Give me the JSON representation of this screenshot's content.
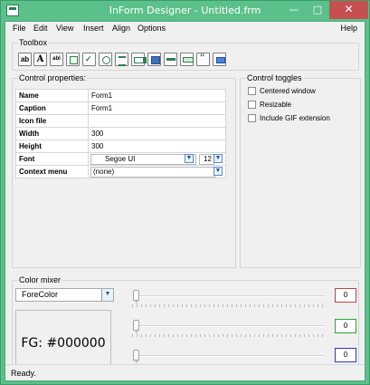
{
  "window": {
    "title": "InForm Designer - Untitled.frm",
    "controls": {
      "minimize": "—",
      "maximize": "□",
      "close": "✕"
    }
  },
  "menu": [
    "File",
    "Edit",
    "View",
    "Insert",
    "Align",
    "Options"
  ],
  "help": "Help",
  "toolbox": {
    "title": "Toolbox",
    "tools": [
      {
        "name": "button-tool-icon",
        "glyph": "ab"
      },
      {
        "name": "label-tool-icon",
        "glyph": "A"
      },
      {
        "name": "textbox-tool-icon",
        "glyph": "abl"
      },
      {
        "name": "picture-tool-icon",
        "glyph": ""
      },
      {
        "name": "checkbox-tool-icon",
        "glyph": ""
      },
      {
        "name": "radio-tool-icon",
        "glyph": ""
      },
      {
        "name": "list-tool-icon",
        "glyph": ""
      },
      {
        "name": "combo-tool-icon",
        "glyph": ""
      },
      {
        "name": "image-tool-icon",
        "glyph": ""
      },
      {
        "name": "progress-tool-icon",
        "glyph": ""
      },
      {
        "name": "trackbar-tool-icon",
        "glyph": ""
      },
      {
        "name": "quote-tool-icon",
        "glyph": ""
      },
      {
        "name": "frame-tool-icon",
        "glyph": ""
      }
    ]
  },
  "properties": {
    "title": "Control properties:",
    "rows": [
      {
        "key": "Name",
        "value": "Form1"
      },
      {
        "key": "Caption",
        "value": "Form1"
      },
      {
        "key": "Icon file",
        "value": ""
      },
      {
        "key": "Width",
        "value": "300"
      },
      {
        "key": "Height",
        "value": "300"
      },
      {
        "key": "Font",
        "value": "Segoe UI"
      },
      {
        "key": "Context menu",
        "value": "(none)"
      }
    ],
    "font_size": "12"
  },
  "toggles": {
    "title": "Control toggles",
    "items": [
      "Centered window",
      "Resizable",
      "Include GIF extension"
    ]
  },
  "color_mixer": {
    "title": "Color mixer",
    "target": "ForeColor",
    "preview": "FG: #000000",
    "channels": [
      {
        "name": "red",
        "value": "0",
        "color": "#d33b3b"
      },
      {
        "name": "green",
        "value": "0",
        "color": "#2fa72f"
      },
      {
        "name": "blue",
        "value": "0",
        "color": "#2c36c9"
      }
    ]
  },
  "status": "Ready."
}
